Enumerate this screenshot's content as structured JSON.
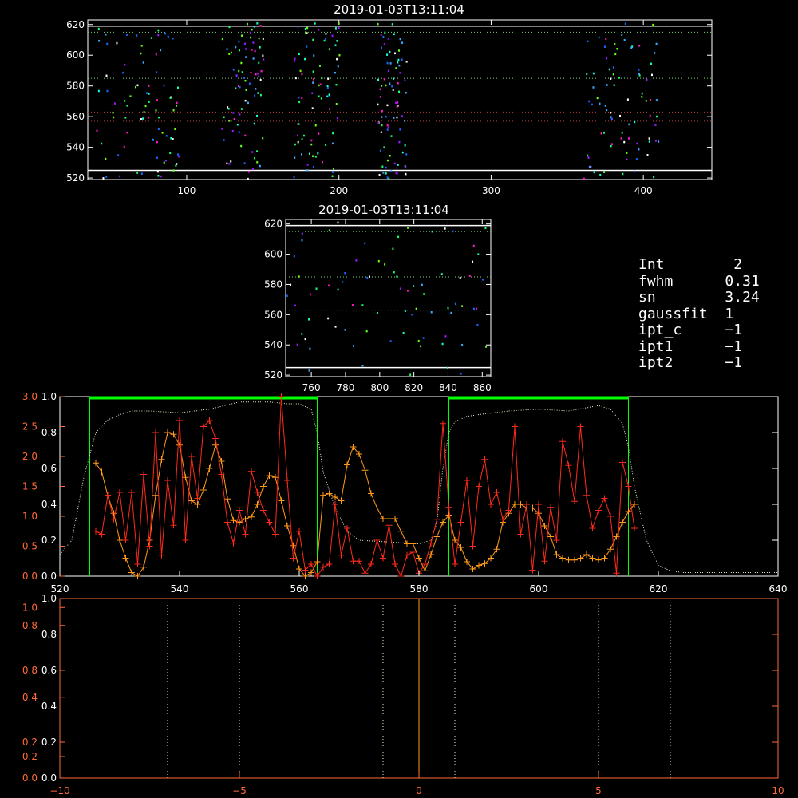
{
  "colors": {
    "white": "#ffffff",
    "red": "#ff2a1a",
    "orange": "#ff9a1a",
    "axis_red": "#ff6a3a",
    "green": "#00ff00",
    "dot_green": "#7ad67a",
    "dot_red": "#c04040",
    "pale": "#e6f2c8",
    "specks": [
      "#1a66ff",
      "#3aaaff",
      "#9a1aff",
      "#ff1acc",
      "#1aff6a",
      "#6aff1a",
      "#ffffff",
      "#1affcc"
    ]
  },
  "info": [
    {
      "key": "Int",
      "value": "2"
    },
    {
      "key": "fwhm",
      "value": "0.31"
    },
    {
      "key": "sn",
      "value": "3.24"
    },
    {
      "key": "gaussfit",
      "value": "1"
    },
    {
      "key": "ipt_c",
      "value": "−1"
    },
    {
      "key": "ipt1",
      "value": "−1"
    },
    {
      "key": "ipt2",
      "value": "−1"
    }
  ],
  "chart_data": [
    {
      "type": "scatter",
      "title": "2019-01-03T13:11:04",
      "xlim": [
        35,
        445
      ],
      "ylim": [
        519,
        623
      ],
      "xticks": [
        "100",
        "200",
        "300",
        "400"
      ],
      "yticks": [
        "520",
        "540",
        "560",
        "580",
        "600",
        "620"
      ],
      "white_lines_y": [
        525,
        619
      ],
      "green_dotted_y": [
        585,
        615
      ],
      "red_dotted_y": [
        557,
        563
      ],
      "point_groups_x": [
        [
          40,
          95
        ],
        [
          122,
          150
        ],
        [
          170,
          200
        ],
        [
          225,
          245
        ],
        [
          360,
          410
        ]
      ],
      "point_count": 420
    },
    {
      "type": "scatter",
      "title": "2019-01-03T13:11:04",
      "xlim": [
        745,
        865
      ],
      "ylim": [
        519,
        623
      ],
      "xticks": [
        "760",
        "780",
        "800",
        "820",
        "840",
        "860"
      ],
      "yticks": [
        "520",
        "540",
        "560",
        "580",
        "600",
        "620"
      ],
      "white_lines_y": [
        525,
        619
      ],
      "green_dotted_y": [
        563,
        585,
        615
      ],
      "point_count": 80
    },
    {
      "type": "line",
      "xlim": [
        520,
        640
      ],
      "xticks": [
        "520",
        "540",
        "560",
        "580",
        "600",
        "620",
        "640"
      ],
      "yticks_white": [
        "0.0",
        "0.2",
        "0.4",
        "0.6",
        "0.8",
        "1.0"
      ],
      "yticks_red": [
        "0.0",
        "0.5",
        "1.0",
        "1.5",
        "2.0",
        "2.5",
        "3.0"
      ],
      "ylim_white": [
        0,
        1.0
      ],
      "ylim_red": [
        0,
        3.0
      ],
      "windows": [
        [
          525,
          563
        ],
        [
          585,
          615
        ]
      ],
      "orange": {
        "x": [
          526,
          527,
          528,
          529,
          530,
          531,
          532,
          533,
          534,
          535,
          536,
          537,
          538,
          539,
          540,
          541,
          542,
          543,
          544,
          545,
          546,
          547,
          548,
          549,
          550,
          551,
          552,
          553,
          554,
          555,
          556,
          557,
          558,
          559,
          560,
          561,
          562,
          563,
          564,
          565,
          566,
          567,
          568,
          569,
          570,
          571,
          572,
          573,
          574,
          575,
          576,
          577,
          578,
          579,
          580,
          581,
          582,
          583,
          584,
          585,
          586,
          587,
          588,
          589,
          590,
          591,
          592,
          593,
          594,
          595,
          596,
          597,
          598,
          599,
          600,
          601,
          602,
          603,
          604,
          605,
          606,
          607,
          608,
          609,
          610,
          611,
          612,
          613,
          614,
          615,
          616
        ],
        "y": [
          0.63,
          0.58,
          0.45,
          0.35,
          0.2,
          0.1,
          0.02,
          0.0,
          0.05,
          0.2,
          0.45,
          0.65,
          0.8,
          0.79,
          0.73,
          0.55,
          0.42,
          0.4,
          0.48,
          0.6,
          0.73,
          0.64,
          0.43,
          0.31,
          0.3,
          0.32,
          0.33,
          0.4,
          0.5,
          0.56,
          0.55,
          0.42,
          0.28,
          0.17,
          0.04,
          0.0,
          0.02,
          0.08,
          0.45,
          0.46,
          0.44,
          0.42,
          0.62,
          0.72,
          0.68,
          0.59,
          0.46,
          0.38,
          0.32,
          0.32,
          0.32,
          0.25,
          0.18,
          0.18,
          0.1,
          0.03,
          0.12,
          0.22,
          0.3,
          0.34,
          0.2,
          0.16,
          0.08,
          0.04,
          0.06,
          0.07,
          0.1,
          0.15,
          0.3,
          0.35,
          0.4,
          0.4,
          0.38,
          0.38,
          0.35,
          0.28,
          0.22,
          0.12,
          0.1,
          0.09,
          0.09,
          0.1,
          0.12,
          0.1,
          0.09,
          0.1,
          0.15,
          0.22,
          0.3,
          0.36,
          0.4
        ]
      },
      "red": {
        "x": [
          526,
          527,
          528,
          529,
          530,
          531,
          532,
          533,
          534,
          535,
          536,
          537,
          538,
          539,
          540,
          541,
          542,
          543,
          544,
          545,
          546,
          547,
          548,
          549,
          550,
          551,
          552,
          553,
          554,
          555,
          556,
          557,
          558,
          559,
          560,
          561,
          562,
          563,
          564,
          565,
          566,
          567,
          568,
          569,
          570,
          571,
          572,
          573,
          574,
          575,
          576,
          577,
          578,
          579,
          580,
          581,
          582,
          583,
          584,
          585,
          586,
          587,
          588,
          589,
          590,
          591,
          592,
          593,
          594,
          595,
          596,
          597,
          598,
          599,
          600,
          601,
          602,
          603,
          604,
          605,
          606,
          607,
          608,
          609,
          610,
          611,
          612,
          613,
          614,
          615,
          616
        ],
        "y": [
          0.75,
          0.7,
          1.35,
          0.95,
          1.4,
          0.6,
          1.4,
          0.2,
          1.7,
          0.5,
          2.4,
          0.35,
          1.6,
          0.85,
          2.6,
          0.6,
          2.0,
          1.3,
          2.5,
          2.6,
          2.3,
          1.7,
          0.9,
          0.55,
          1.1,
          0.7,
          1.75,
          1.4,
          1.1,
          0.9,
          0.7,
          3.0,
          1.6,
          0.3,
          0.75,
          0.1,
          0.2,
          0.0,
          0.15,
          0.2,
          1.2,
          0.35,
          0.8,
          0.25,
          0.25,
          0.05,
          0.2,
          0.6,
          0.3,
          0.85,
          0.2,
          0.0,
          0.35,
          0.4,
          0.05,
          0.2,
          0.55,
          0.95,
          2.55,
          1.15,
          0.2,
          0.9,
          1.6,
          0.5,
          1.5,
          1.95,
          1.2,
          1.4,
          0.95,
          1.1,
          2.5,
          0.7,
          1.2,
          0.1,
          1.2,
          0.25,
          1.15,
          0.6,
          2.25,
          1.85,
          1.25,
          2.5,
          1.35,
          0.8,
          1.1,
          1.3,
          1.0,
          0.05,
          1.9,
          1.5,
          0.8
        ]
      },
      "pale_dotted": {
        "x": [
          520,
          522,
          524,
          526,
          528,
          530,
          532,
          535,
          540,
          545,
          550,
          555,
          558,
          560,
          562,
          563,
          564,
          566,
          568,
          570,
          575,
          580,
          582,
          583,
          584,
          585,
          586,
          588,
          590,
          595,
          600,
          605,
          610,
          612,
          614,
          615,
          616,
          618,
          620,
          622,
          624,
          630,
          640
        ],
        "y": [
          0.12,
          0.2,
          0.55,
          0.8,
          0.87,
          0.9,
          0.92,
          0.92,
          0.91,
          0.93,
          0.97,
          0.97,
          0.96,
          0.96,
          0.93,
          0.8,
          0.58,
          0.38,
          0.25,
          0.2,
          0.19,
          0.18,
          0.2,
          0.3,
          0.6,
          0.8,
          0.86,
          0.89,
          0.9,
          0.92,
          0.93,
          0.92,
          0.95,
          0.93,
          0.85,
          0.72,
          0.5,
          0.2,
          0.06,
          0.03,
          0.02,
          0.02,
          0.02
        ]
      }
    },
    {
      "type": "line",
      "xlim": [
        -10,
        10
      ],
      "xticks": [
        "−10",
        "−5",
        "0",
        "5",
        "10"
      ],
      "yticks_white": [
        "0.0",
        "0.2",
        "0.4",
        "0.6",
        "0.8",
        "1.0"
      ],
      "yticks_red": [
        "0.0",
        "0.2",
        "0.2",
        "0.4",
        "0.8",
        "0.8",
        "1.0"
      ],
      "white_dotted_x": [
        -7,
        -5,
        -1,
        1,
        5,
        7
      ],
      "orange_solid_x": [
        0
      ]
    }
  ]
}
